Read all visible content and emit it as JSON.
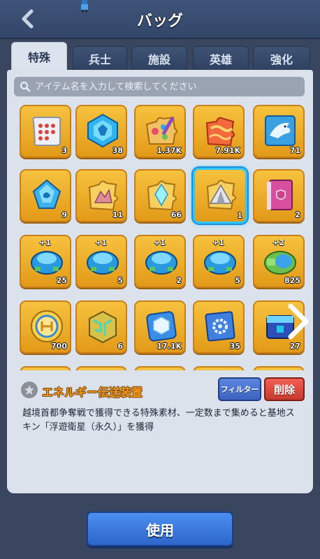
{
  "header": {
    "title": "バッグ"
  },
  "tabs": [
    {
      "label": "特殊",
      "active": true
    },
    {
      "label": "兵士",
      "active": false
    },
    {
      "label": "施設",
      "active": false
    },
    {
      "label": "英雄",
      "active": false
    },
    {
      "label": "強化",
      "active": false
    }
  ],
  "search": {
    "placeholder": "アイテム名を入力して検索してください"
  },
  "items": [
    {
      "icon": "scroll-icon",
      "count": "3"
    },
    {
      "icon": "blue-crystal-icon",
      "count": "38"
    },
    {
      "icon": "paint-puzzle-icon",
      "count": "1.37K"
    },
    {
      "icon": "red-puzzle-icon",
      "count": "7.91K"
    },
    {
      "icon": "shark-card-icon",
      "count": "71"
    },
    {
      "icon": "blue-gem-icon",
      "count": "9"
    },
    {
      "icon": "gold-puzzle-icon",
      "count": "11"
    },
    {
      "icon": "crystal-puzzle-icon",
      "count": "66"
    },
    {
      "icon": "tent-puzzle-icon",
      "count": "1",
      "selected": true
    },
    {
      "icon": "pink-book-icon",
      "count": "2"
    },
    {
      "icon": "blue-pod-icon",
      "count": "25",
      "plus": "+1"
    },
    {
      "icon": "blue-pod-icon",
      "count": "5",
      "plus": "+1"
    },
    {
      "icon": "blue-pod-icon",
      "count": "2",
      "plus": "+1"
    },
    {
      "icon": "blue-pod-icon",
      "count": "5",
      "plus": "+1"
    },
    {
      "icon": "green-pod-icon",
      "count": "825",
      "plus": "+2"
    },
    {
      "icon": "gold-coin-icon",
      "count": "700"
    },
    {
      "icon": "circuit-cube-icon",
      "count": "6"
    },
    {
      "icon": "ice-cube-icon",
      "count": "17.1K"
    },
    {
      "icon": "gear-card-icon",
      "count": "35"
    },
    {
      "icon": "robot-chest-icon",
      "count": "27"
    }
  ],
  "detail": {
    "name": "エネルギー伝送装置",
    "description": "越境首都争奪戦で獲得できる特殊素材、一定数まで集めると基地スキン「浮遊衛星（永久）」を獲得"
  },
  "buttons": {
    "filter": "フィルター",
    "delete": "削除",
    "use": "使用"
  },
  "colors": {
    "tile": "#f0b030",
    "selected_border": "#2fc6ff",
    "use_button": "#3a7ddc",
    "delete_button": "#e24a3e",
    "filter_button": "#4a72d6",
    "item_name": "#f39a1e"
  }
}
